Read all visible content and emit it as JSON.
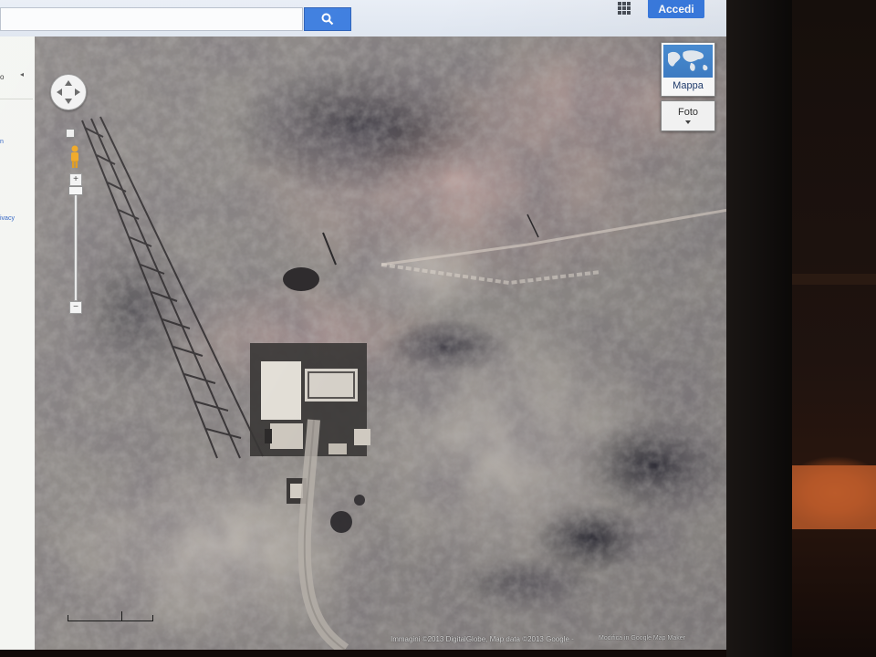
{
  "topbar": {
    "search_value": "",
    "signin_label": "Accedi",
    "search_icon": "search-icon",
    "apps_icon": "apps-grid-icon"
  },
  "left_panel": {
    "top_label": "o",
    "links": [
      "n",
      "",
      "ivacy"
    ]
  },
  "map_controls": {
    "zoom_in_label": "+",
    "zoom_out_label": "−",
    "pan_icon": "pan-arrows-icon",
    "pegman_icon": "pegman-icon"
  },
  "map_type": {
    "map_label": "Mappa",
    "photo_label": "Foto"
  },
  "footer": {
    "attribution": "Immagini ©2013 DigitalGlobe, Map data ©2013 Google -",
    "report_link": "Modifica in Google Map Maker"
  },
  "colors": {
    "accent": "#3a7be0",
    "map_terrain": "#8d8a86"
  }
}
